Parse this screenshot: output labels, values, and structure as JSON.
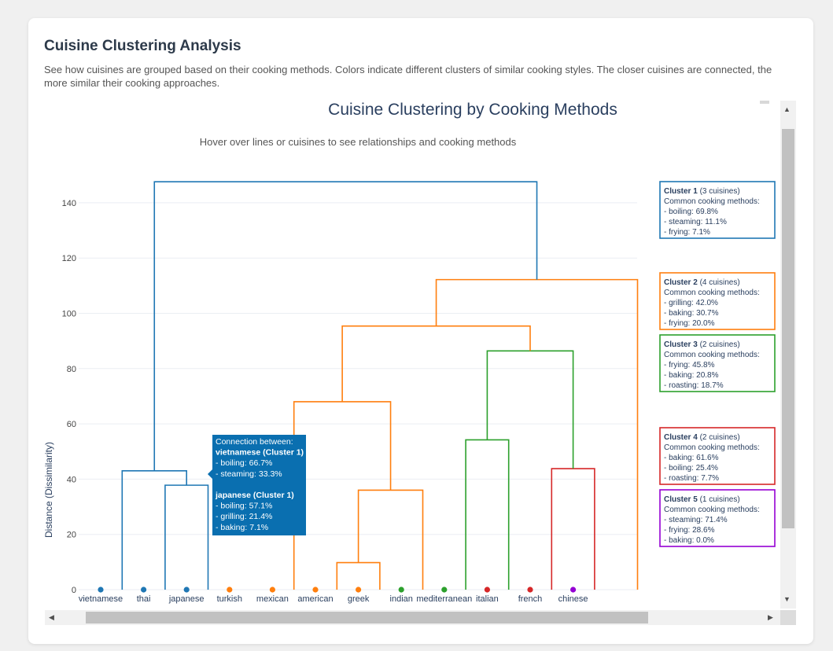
{
  "page": {
    "title": "Cuisine Clustering Analysis",
    "description": "See how cuisines are grouped based on their cooking methods. Colors indicate different clusters of similar cooking styles. The closer cuisines are connected, the more similar their cooking approaches."
  },
  "chart_data": {
    "type": "dendrogram",
    "title": "Cuisine Clustering by Cooking Methods",
    "subtitle": "Hover over lines or cuisines to see relationships and cooking methods",
    "ylabel": "Distance (Dissimilarity)",
    "ylim": [
      0,
      150
    ],
    "yticks": [
      0,
      20,
      40,
      60,
      80,
      100,
      120,
      140
    ],
    "grid": true,
    "leaves": [
      {
        "name": "vietnamese",
        "color": "#1f77b4"
      },
      {
        "name": "thai",
        "color": "#1f77b4"
      },
      {
        "name": "japanese",
        "color": "#1f77b4"
      },
      {
        "name": "turkish",
        "color": "#ff7f0e"
      },
      {
        "name": "mexican",
        "color": "#ff7f0e"
      },
      {
        "name": "american",
        "color": "#ff7f0e"
      },
      {
        "name": "greek",
        "color": "#ff7f0e"
      },
      {
        "name": "indian",
        "color": "#2ca02c"
      },
      {
        "name": "mediterranean",
        "color": "#2ca02c"
      },
      {
        "name": "italian",
        "color": "#d62728"
      },
      {
        "name": "french",
        "color": "#d62728"
      },
      {
        "name": "chinese",
        "color": "#9400d3"
      }
    ],
    "links": [
      {
        "x": [
          2.5,
          2.5,
          3.5,
          3.5
        ],
        "y": [
          0,
          37.8,
          37.8,
          0
        ],
        "color": "#1f77b4"
      },
      {
        "x": [
          1.5,
          1.5,
          3.0,
          3.0
        ],
        "y": [
          0,
          43.0,
          43.0,
          37.8
        ],
        "color": "#1f77b4"
      },
      {
        "x": [
          6.5,
          6.5,
          7.5,
          7.5
        ],
        "y": [
          0,
          9.8,
          9.8,
          0
        ],
        "color": "#ff7f0e"
      },
      {
        "x": [
          7.0,
          7.0,
          8.5,
          8.5
        ],
        "y": [
          9.8,
          36.0,
          36.0,
          0
        ],
        "color": "#ff7f0e"
      },
      {
        "x": [
          5.5,
          5.5,
          7.75,
          7.75
        ],
        "y": [
          0,
          68.0,
          68.0,
          36.0
        ],
        "color": "#ff7f0e"
      },
      {
        "x": [
          9.5,
          9.5,
          10.5,
          10.5
        ],
        "y": [
          0,
          54.2,
          54.2,
          0
        ],
        "color": "#2ca02c"
      },
      {
        "x": [
          11.5,
          11.5,
          12.5,
          12.5
        ],
        "y": [
          0,
          43.8,
          43.8,
          0
        ],
        "color": "#d62728"
      },
      {
        "x": [
          10.0,
          10.0,
          12.0,
          12.0
        ],
        "y": [
          54.2,
          86.4,
          86.4,
          43.8
        ],
        "color": "#2ca02c"
      },
      {
        "x": [
          6.625,
          6.625,
          11.0,
          11.0
        ],
        "y": [
          68.0,
          95.4,
          95.4,
          86.4
        ],
        "color": "#ff7f0e"
      },
      {
        "x": [
          8.8125,
          8.8125,
          13.5,
          13.5
        ],
        "y": [
          95.4,
          112.2,
          112.2,
          0
        ],
        "color": "#ff7f0e"
      },
      {
        "x": [
          2.25,
          2.25,
          11.15625,
          11.15625
        ],
        "y": [
          43.0,
          147.6,
          147.6,
          112.2
        ],
        "color": "#1f77b4"
      }
    ],
    "clusters": [
      {
        "title": "Cluster 1",
        "count": "(3 cuisines)",
        "heading": "Common cooking methods:",
        "methods": [
          "- boiling: 69.8%",
          "- steaming: 11.1%",
          "- frying: 7.1%"
        ],
        "color": "#1f77b4"
      },
      {
        "title": "Cluster 2",
        "count": "(4 cuisines)",
        "heading": "Common cooking methods:",
        "methods": [
          "- grilling: 42.0%",
          "- baking: 30.7%",
          "- frying: 20.0%"
        ],
        "color": "#ff7f0e"
      },
      {
        "title": "Cluster 3",
        "count": "(2 cuisines)",
        "heading": "Common cooking methods:",
        "methods": [
          "- frying: 45.8%",
          "- baking: 20.8%",
          "- roasting: 18.7%"
        ],
        "color": "#2ca02c"
      },
      {
        "title": "Cluster 4",
        "count": "(2 cuisines)",
        "heading": "Common cooking methods:",
        "methods": [
          "- baking: 61.6%",
          "- boiling: 25.4%",
          "- roasting: 7.7%"
        ],
        "color": "#d62728"
      },
      {
        "title": "Cluster 5",
        "count": "(1 cuisines)",
        "heading": "Common cooking methods:",
        "methods": [
          "- steaming: 71.4%",
          "- frying: 28.6%",
          "- baking: 0.0%"
        ],
        "color": "#9400d3"
      }
    ],
    "tooltip": {
      "lines": [
        "Connection between:",
        "vietnamese (Cluster 1)",
        "- boiling: 66.7%",
        "- steaming: 33.3%",
        "",
        "japanese (Cluster 1)",
        "- boiling: 57.1%",
        "- grilling: 21.4%",
        "- baking: 7.1%"
      ],
      "color": "#0a6fb0"
    }
  }
}
